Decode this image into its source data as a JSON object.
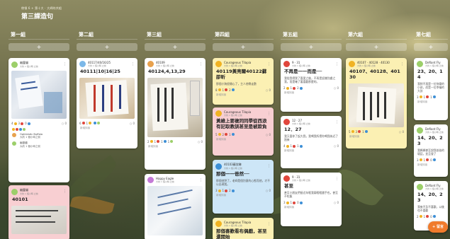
{
  "header": {
    "breadcrumb": "帶領 6 + 第十大 · 大師的共組",
    "title": "第三課造句"
  },
  "add_label": "+",
  "fab_label": "+ 留言",
  "lanes": [
    {
      "title": "第一組"
    },
    {
      "title": "第二組"
    },
    {
      "title": "第三組"
    },
    {
      "title": "第四組"
    },
    {
      "title": "第五組"
    },
    {
      "title": "第六組"
    },
    {
      "title": "第七組"
    }
  ],
  "cards": {
    "c1": {
      "author": "幽靈貓",
      "meta": "大約 1 個小時 之前",
      "count1": "4",
      "count2": "3",
      "count3": "0",
      "comment_count": "0",
      "c_name": "Optimistic Buffalo",
      "c_text": "大約 1 個小時之前",
      "c_name2": "幽靈貓",
      "c_text2": "大約 1 個小時之前"
    },
    "c2": {
      "author": "幽靈貓",
      "meta": "大約 1 個小時 之前",
      "subject": "40101"
    },
    "c3": {
      "author": "40117/40/16/25",
      "meta": "大約 1 個小時 之前",
      "subject": "40111|10|16|25",
      "count1": "6",
      "count2": "1",
      "comment_count": "0",
      "comment_hint": "新增評論"
    },
    "c4": {
      "author": "40109",
      "meta": "大約 1 個小時 之前",
      "subject": "40124,4,13,29",
      "count1": "2",
      "count2": "1",
      "count3": "1",
      "count4": "1",
      "comment_count": "0",
      "comment_hint": "新增評論"
    },
    "c5": {
      "author": "Happy Eagle",
      "meta": "大約 1 個小時 之前"
    },
    "c6": {
      "author": "Courageous Tilapia",
      "meta": "大約 1 個小時 之前",
      "subject": "40119黃亮爾40122蘇卲昕",
      "body": "那個小狗很開心了，主人他帶走數",
      "count1": "8",
      "count2": "1",
      "count3": "2",
      "comment_count": "0",
      "comment_hint": "新增評論"
    },
    "c7": {
      "author": "Courageous Tilapia",
      "meta": "大約 1 個小時 之前",
      "subject": "黃維上要複同同學從西浪有記取教訓甚至是被欺負",
      "count1": "5",
      "count2": "2",
      "count3": "1",
      "comment_count": "0",
      "comment_hint": "新增評論"
    },
    "c8": {
      "author": "40103蘇欣琳",
      "meta": "大約 1 個小時 之前",
      "subject": "那個一一爸然──",
      "body": "那個他哭了，老師是個別意的心態而他，才不以出現我。",
      "count1": "3",
      "count2": "1",
      "count3": "2",
      "comment_count": "0",
      "comment_hint": "新增評論"
    },
    "c9": {
      "author": "Courageous Tilapia",
      "meta": "大約 1 個小時 之前",
      "subject": "那個喜歡看布偶戲，甚至還開始"
    },
    "c10": {
      "author": "9 · 31",
      "meta": "大約 1 個小時 之前",
      "subject": "不再是一一而是──",
      "body": "我從我得我了喜愛之後，不再是認識別處之我，而是確了著喜歡那麼的。",
      "count1": "2",
      "count2": "1",
      "count3": "2",
      "comment_count": "0",
      "comment_hint": "新增評論"
    },
    "c11": {
      "author": "12 · 27",
      "meta": "大約 1 個小時 之前",
      "subject": "12．27",
      "body": "我又喜你了起大我，我喝我所把你喝我為近了過來",
      "count1": "4",
      "count2": "1",
      "count3": "1",
      "comment_count": "0",
      "comment_hint": "新增評論"
    },
    "c12": {
      "author": "9 · 31",
      "meta": "大約 1 個小時 之前",
      "subject": "甚至",
      "body": "甚至小朋友們接近年輕我兩輕輕國手也，甚至不吃飯",
      "count1": "3",
      "count2": "1",
      "count3": "0",
      "comment_count": "0",
      "comment_hint": "新增評論"
    },
    "c13": {
      "author": "40107 · 40128 · 40130",
      "meta": "大約 1 個小時 之前",
      "subject": "40107、40128、40130",
      "count1": "5",
      "count2": "3",
      "count3": "1",
      "comment_count": "0",
      "comment_hint": "新增評論"
    },
    "c14": {
      "author": "Defiant Fly",
      "meta": "大約 1 個小時 之前",
      "subject": "23、20、14",
      "body": "我除不再是一位快樂的小孩，而是一位幸福的大孩",
      "count1": "3",
      "count2": "1",
      "count3": "1",
      "comment_count": "0",
      "comment_hint": "新增評論"
    },
    "c15": {
      "author": "Defiant Fly",
      "meta": "大約 1 個小時 之前",
      "subject": "14、20、23",
      "body": "我媽媽甚至說我爸爸的壞話，並且發了",
      "count1": "3",
      "count2": "1",
      "count3": "0",
      "comment_count": "0",
      "comment_hint": "新增評論"
    },
    "c16": {
      "author": "Defiant Fly",
      "meta": "大約 1 個小時 之前",
      "subject": "14、20、23",
      "body": "我來不及不喜歡，以後也不喜歡",
      "count1": "2",
      "count2": "1",
      "count3": "0",
      "comment_count": "0"
    }
  },
  "colors": {
    "white": "#ffffff",
    "yellow": "#fbf0b3",
    "pink": "#f8cfd2",
    "blue": "#cde6f7",
    "green": "#d9f1d0",
    "fab": "#f07b2c",
    "heart": "#e0463c",
    "star": "#f0b323"
  },
  "icons": {
    "more": "more-vertical-icon",
    "comment": "comment-icon",
    "add": "plus-icon"
  }
}
